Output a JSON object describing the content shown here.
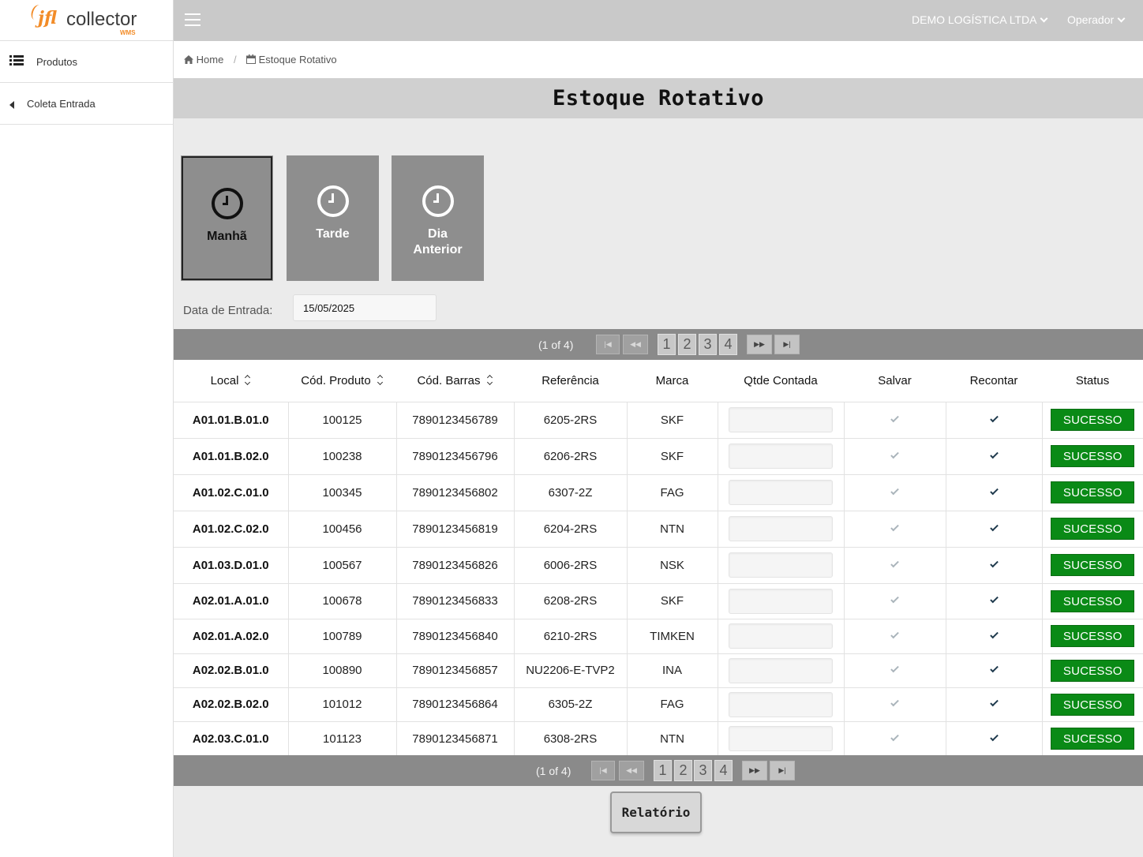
{
  "brand": {
    "name_jfl": "jfl",
    "name_collector": "collector",
    "tagline": "WMS",
    "accent": "#f28c28"
  },
  "sidebar": {
    "items": [
      {
        "label": "Produtos",
        "icon": "list-icon"
      },
      {
        "label": "Coleta Entrada",
        "icon": "caret-left-icon"
      }
    ]
  },
  "topbar": {
    "company": "DEMO LOGÍSTICA LTDA",
    "user": "Operador"
  },
  "breadcrumb": {
    "home": "Home",
    "current": "Estoque Rotativo"
  },
  "page_title": "Estoque Rotativo",
  "shifts": [
    {
      "label": "Manhã",
      "active": true
    },
    {
      "label": "Tarde",
      "active": false
    },
    {
      "label": "Dia Anterior",
      "active": false
    }
  ],
  "date_filter": {
    "label": "Data de Entrada:",
    "value": "15/05/2025"
  },
  "pagination": {
    "info": "(1 of 4)",
    "pages": [
      "1",
      "2",
      "3",
      "4"
    ],
    "current_page": 1
  },
  "table": {
    "columns": [
      "Local",
      "Cód. Produto",
      "Cód. Barras",
      "Referência",
      "Marca",
      "Qtde Contada",
      "Salvar",
      "Recontar",
      "Status"
    ],
    "rows": [
      {
        "local": "A01.01.B.01.0",
        "codigo": "100125",
        "barras": "7890123456789",
        "referencia": "6205-2RS",
        "marca": "SKF",
        "qtde": "",
        "status": "SUCESSO"
      },
      {
        "local": "A01.01.B.02.0",
        "codigo": "100238",
        "barras": "7890123456796",
        "referencia": "6206-2RS",
        "marca": "SKF",
        "qtde": "",
        "status": "SUCESSO"
      },
      {
        "local": "A01.02.C.01.0",
        "codigo": "100345",
        "barras": "7890123456802",
        "referencia": "6307-2Z",
        "marca": "FAG",
        "qtde": "",
        "status": "SUCESSO"
      },
      {
        "local": "A01.02.C.02.0",
        "codigo": "100456",
        "barras": "7890123456819",
        "referencia": "6204-2RS",
        "marca": "NTN",
        "qtde": "",
        "status": "SUCESSO"
      },
      {
        "local": "A01.03.D.01.0",
        "codigo": "100567",
        "barras": "7890123456826",
        "referencia": "6006-2RS",
        "marca": "NSK",
        "qtde": "",
        "status": "SUCESSO"
      },
      {
        "local": "A02.01.A.01.0",
        "codigo": "100678",
        "barras": "7890123456833",
        "referencia": "6208-2RS",
        "marca": "SKF",
        "qtde": "",
        "status": "SUCESSO"
      },
      {
        "local": "A02.01.A.02.0",
        "codigo": "100789",
        "barras": "7890123456840",
        "referencia": "6210-2RS",
        "marca": "TIMKEN",
        "qtde": "",
        "status": "SUCESSO"
      },
      {
        "local": "A02.02.B.01.0",
        "codigo": "100890",
        "barras": "7890123456857",
        "referencia": "NU2206-E-TVP2",
        "marca": "INA",
        "qtde": "",
        "status": "SUCESSO"
      },
      {
        "local": "A02.02.B.02.0",
        "codigo": "101012",
        "barras": "7890123456864",
        "referencia": "6305-2Z",
        "marca": "FAG",
        "qtde": "",
        "status": "SUCESSO"
      },
      {
        "local": "A02.03.C.01.0",
        "codigo": "101123",
        "barras": "7890123456871",
        "referencia": "6308-2RS",
        "marca": "NTN",
        "qtde": "",
        "status": "SUCESSO"
      }
    ]
  },
  "report_button": "Relatório",
  "colors": {
    "topbar": "#c9c9c9",
    "shift_button": "#8e8e8e",
    "paginator": "#8a8a8a",
    "status_success": "#0a8a16"
  }
}
